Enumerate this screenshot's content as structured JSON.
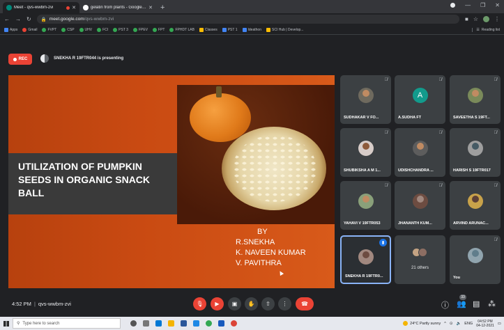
{
  "browser": {
    "tabs": [
      {
        "label": "Meet - qvs-wwbm-zvi",
        "active": true
      },
      {
        "label": "gelatin from plants - Google Sea",
        "active": false
      }
    ],
    "new_tab": "+",
    "url_host": "meet.google.com",
    "url_path": "/qvs-wwbm-zvi",
    "bookmarks": [
      "Apps",
      "Gmail",
      "FVPT",
      "CSP",
      "UHV",
      "FCI",
      "PST 3",
      "FPEV",
      "FPT",
      "FPHDT LAB",
      "Classes",
      "PST 1",
      "Ideathon",
      "SCI Hub | Develop..."
    ],
    "reading_list": "Reading list"
  },
  "meet": {
    "rec_label": "REC",
    "presenting_text": "SNEKHA R 19FTR044 is presenting",
    "time": "4:52 PM",
    "meeting_code": "qvs-wwbm-zvi",
    "people_count": "33"
  },
  "slide": {
    "title": "UTILIZATION OF PUMPKIN SEEDS IN ORGANIC SNACK BALL",
    "by": "BY",
    "authors": [
      "R.SNEKHA",
      "K. NAVEEN KUMAR",
      "V. PAVITHRA"
    ]
  },
  "participants": [
    {
      "name": "SUDHAKAR V FO...",
      "initial": ""
    },
    {
      "name": "A.SUDHA FT",
      "initial": "A"
    },
    {
      "name": "SAVEETHA S 19FT...",
      "initial": ""
    },
    {
      "name": "SHUBIKSHA A M 1...",
      "initial": ""
    },
    {
      "name": "UDISHCHANDRA ...",
      "initial": ""
    },
    {
      "name": "HARISH S 19FTR017",
      "initial": ""
    },
    {
      "name": "YAHAVI V 19FTR053",
      "initial": ""
    },
    {
      "name": "JHANANTH KUM...",
      "initial": ""
    },
    {
      "name": "ARVIND ARUNAC...",
      "initial": ""
    },
    {
      "name": "SNEKHA R 19FTR0...",
      "initial": ""
    },
    {
      "name": "21 others",
      "initial": ""
    },
    {
      "name": "You",
      "initial": ""
    }
  ],
  "taskbar": {
    "search_placeholder": "Type here to search",
    "weather": "24°C Partly sunny",
    "lang": "ENG",
    "time": "04:52 PM",
    "date": "04-12-2021"
  },
  "colors": {
    "meet_bg": "#202124",
    "tile_bg": "#3c4043",
    "rec_red": "#ea4335",
    "slide_orange": "#c94a12",
    "active_border": "#8ab4f8"
  }
}
